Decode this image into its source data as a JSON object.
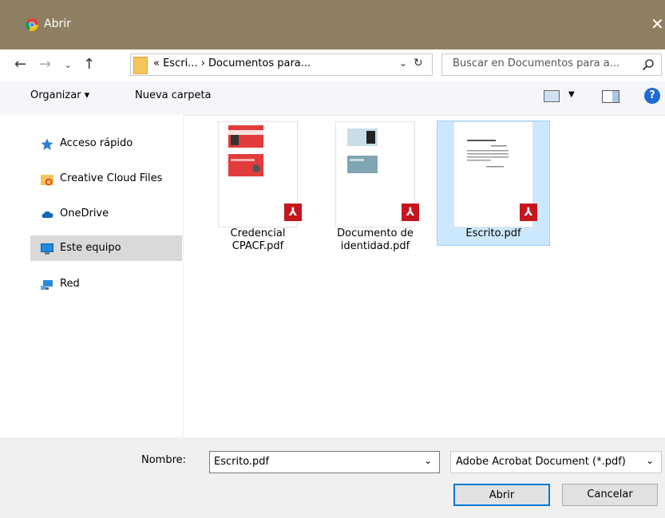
{
  "window": {
    "title": "Abrir",
    "close_glyph": "✕"
  },
  "address": {
    "back_glyph": "←",
    "forward_glyph": "→",
    "recent_glyph": "⌄",
    "up_glyph": "↑",
    "breadcrumb": "« Escri...  ›  Documentos para...",
    "refresh_glyph": "↻",
    "dropdown_glyph": "⌄"
  },
  "search": {
    "placeholder": "Buscar en Documentos para a...",
    "icon": "search-icon"
  },
  "toolbar": {
    "organize_label": "Organizar ▾",
    "new_folder_label": "Nueva carpeta",
    "view_drop_glyph": "▼",
    "help_glyph": "?"
  },
  "sidebar": {
    "items": [
      {
        "label": "Acceso rápido",
        "icon": "star-icon"
      },
      {
        "label": "Creative Cloud Files",
        "icon": "creative-cloud-folder-icon"
      },
      {
        "label": "OneDrive",
        "icon": "cloud-icon"
      },
      {
        "label": "Este equipo",
        "icon": "computer-icon",
        "selected": true
      },
      {
        "label": "Red",
        "icon": "network-icon"
      }
    ]
  },
  "files": [
    {
      "line1": "Credencial",
      "line2": "CPACF.pdf",
      "selected": false
    },
    {
      "line1": "Documento de",
      "line2": "identidad.pdf",
      "selected": false
    },
    {
      "line1": "Escrito.pdf",
      "line2": "",
      "selected": true
    }
  ],
  "pdf_badge": "⅄",
  "footer": {
    "name_label": "Nombre:",
    "name_value": "Escrito.pdf",
    "type_value": "Adobe Acrobat Document (*.pdf)",
    "open_label": "Abrir",
    "cancel_label": "Cancelar",
    "dropdown_glyph": "⌄"
  },
  "colors": {
    "title_bar": "#8f7f62",
    "selection": "#cce8ff",
    "accent": "#0078d7",
    "pdf_red": "#c5161d"
  }
}
